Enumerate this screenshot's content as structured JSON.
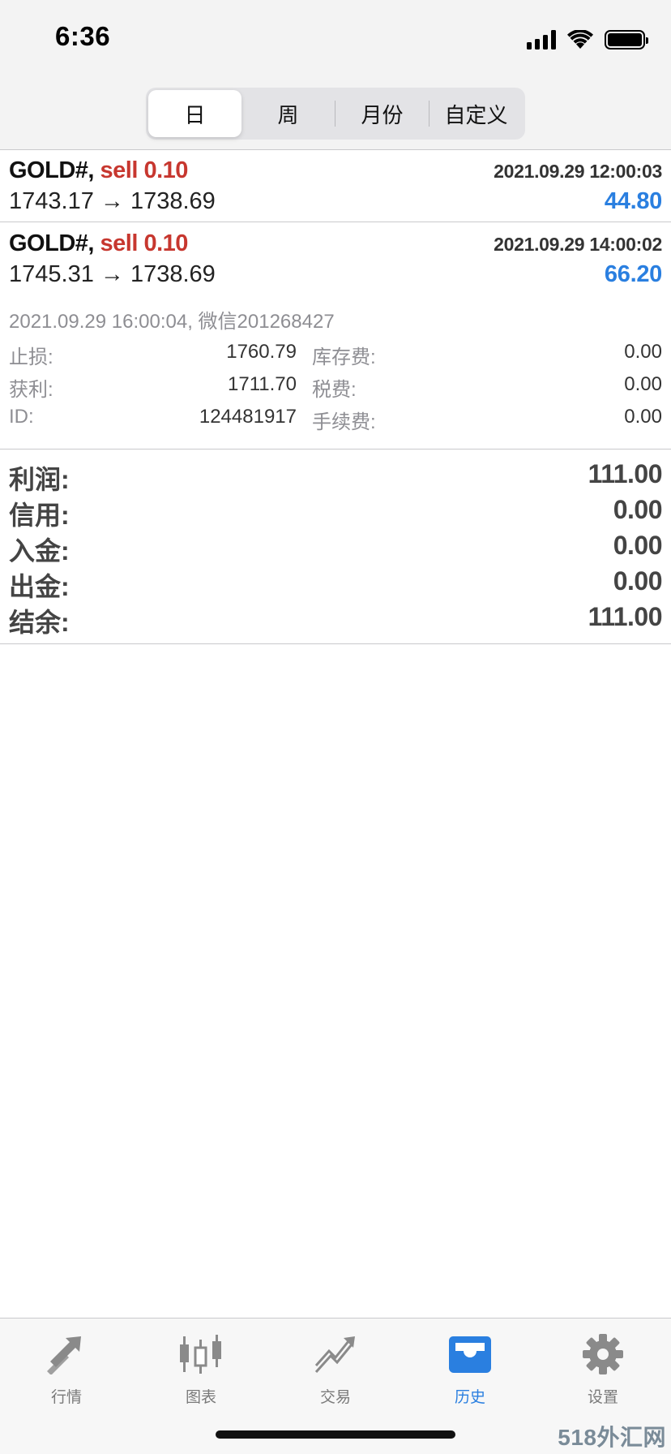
{
  "status_bar": {
    "time": "6:36"
  },
  "segments": [
    {
      "label": "日",
      "active": true
    },
    {
      "label": "周",
      "active": false
    },
    {
      "label": "月份",
      "active": false
    },
    {
      "label": "自定义",
      "active": false
    }
  ],
  "trades": [
    {
      "symbol": "GOLD#,",
      "side": "sell 0.10",
      "time": "2021.09.29 12:00:03",
      "prices": "1743.17 → 1738.69",
      "profit": "44.80"
    },
    {
      "symbol": "GOLD#,",
      "side": "sell 0.10",
      "time": "2021.09.29 14:00:02",
      "prices": "1745.31 → 1738.69",
      "profit": "66.20"
    }
  ],
  "detail": {
    "header": "2021.09.29 16:00:04, 微信201268427",
    "rows": [
      {
        "label1": "止损:",
        "value1": "1760.79",
        "label2": "库存费:",
        "value2": "0.00"
      },
      {
        "label1": "获利:",
        "value1": "1711.70",
        "label2": "税费:",
        "value2": "0.00"
      },
      {
        "label1": "ID:",
        "value1": "124481917",
        "label2": "手续费:",
        "value2": "0.00"
      }
    ]
  },
  "summary": [
    {
      "label": "利润:",
      "value": "111.00"
    },
    {
      "label": "信用:",
      "value": "0.00"
    },
    {
      "label": "入金:",
      "value": "0.00"
    },
    {
      "label": "出金:",
      "value": "0.00"
    },
    {
      "label": "结余:",
      "value": "111.00"
    }
  ],
  "tabbar": [
    {
      "label": "行情",
      "icon": "quotes-arrows-icon",
      "active": false
    },
    {
      "label": "图表",
      "icon": "candlestick-chart-icon",
      "active": false
    },
    {
      "label": "交易",
      "icon": "trade-trend-icon",
      "active": false
    },
    {
      "label": "历史",
      "icon": "history-inbox-icon",
      "active": true
    },
    {
      "label": "设置",
      "icon": "gear-icon",
      "active": false
    }
  ],
  "watermark": "518外汇网",
  "colors": {
    "sell": "#c7372f",
    "profit": "#2a7fe0",
    "active_tab": "#2a7fe0",
    "inactive_icon": "#8a8a8a"
  }
}
